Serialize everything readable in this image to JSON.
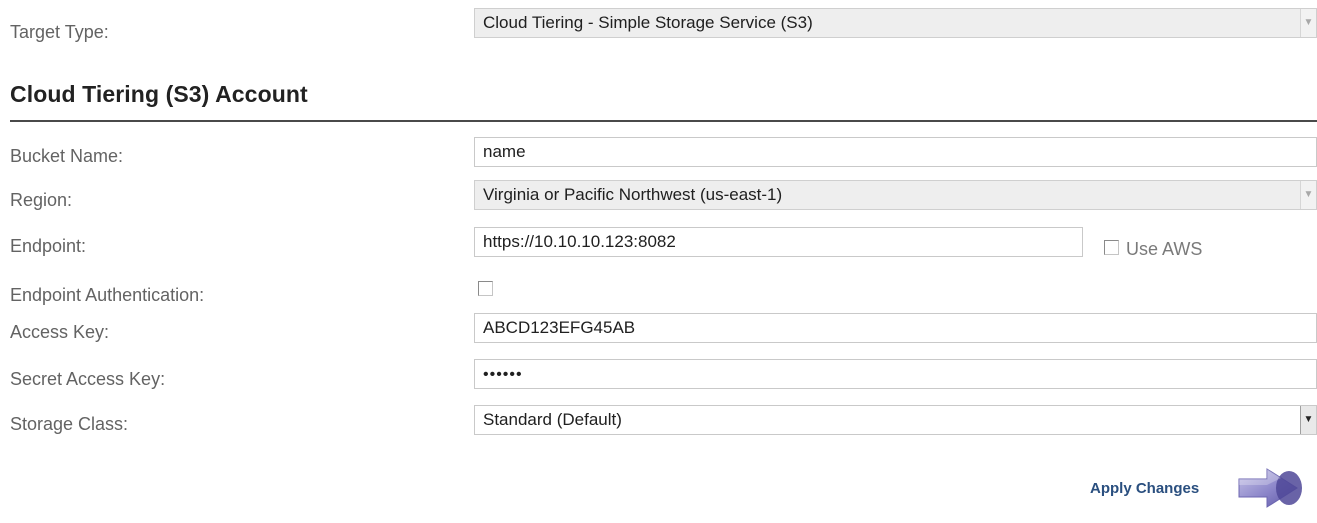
{
  "target_type": {
    "label": "Target Type:",
    "value": "Cloud Tiering - Simple Storage Service (S3)"
  },
  "section": {
    "title": "Cloud Tiering (S3) Account"
  },
  "fields": {
    "bucket_name": {
      "label": "Bucket Name:",
      "value": "name"
    },
    "region": {
      "label": "Region:",
      "value": "Virginia or Pacific Northwest (us-east-1)"
    },
    "endpoint": {
      "label": "Endpoint:",
      "value": "https://10.10.10.123:8082",
      "use_aws_label": "Use AWS",
      "use_aws_checked": false
    },
    "endpoint_auth": {
      "label": "Endpoint Authentication:",
      "checked": false
    },
    "access_key": {
      "label": "Access Key:",
      "value": "ABCD123EFG45AB"
    },
    "secret_access_key": {
      "label": "Secret Access Key:",
      "value": "••••••"
    },
    "storage_class": {
      "label": "Storage Class:",
      "value": "Standard (Default)"
    }
  },
  "actions": {
    "apply_label": "Apply Changes",
    "apply_icon": "arrow-right-icon"
  }
}
